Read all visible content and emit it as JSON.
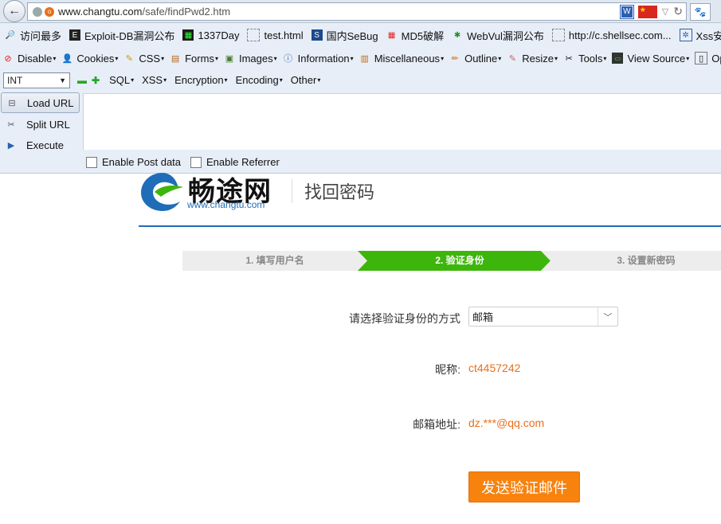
{
  "browser": {
    "url_host": "www.changtu.com",
    "url_path": "/safe/findPwd2.htm"
  },
  "bookmarks": [
    {
      "label": "访问最多",
      "icon": "magnifier-icon"
    },
    {
      "label": "Exploit-DB漏洞公布",
      "icon": "exploitdb-icon"
    },
    {
      "label": "1337Day",
      "icon": "1337day-icon"
    },
    {
      "label": "test.html",
      "icon": "blank-page-icon"
    },
    {
      "label": "国内SeBug",
      "icon": "sebug-icon"
    },
    {
      "label": "MD5破解",
      "icon": "grid-icon"
    },
    {
      "label": "WebVul漏洞公布",
      "icon": "bug-icon"
    },
    {
      "label": "http://c.shellsec.com...",
      "icon": "blank-page-icon"
    },
    {
      "label": "Xss安全测试",
      "icon": "xss-icon"
    }
  ],
  "webdev": [
    {
      "label": "Disable",
      "icon": "disable-icon"
    },
    {
      "label": "Cookies",
      "icon": "cookies-icon"
    },
    {
      "label": "CSS",
      "icon": "css-icon"
    },
    {
      "label": "Forms",
      "icon": "forms-icon"
    },
    {
      "label": "Images",
      "icon": "images-icon"
    },
    {
      "label": "Information",
      "icon": "info-icon"
    },
    {
      "label": "Miscellaneous",
      "icon": "misc-icon"
    },
    {
      "label": "Outline",
      "icon": "outline-icon"
    },
    {
      "label": "Resize",
      "icon": "resize-icon"
    },
    {
      "label": "Tools",
      "icon": "tools-icon"
    },
    {
      "label": "View Source",
      "icon": "view-source-icon"
    },
    {
      "label": "Op",
      "icon": "options-icon"
    }
  ],
  "hackbar": {
    "type_select": "INT",
    "menus": [
      "SQL",
      "XSS",
      "Encryption",
      "Encoding",
      "Other"
    ],
    "load_url": "Load URL",
    "split_url": "Split URL",
    "execute": "Execute",
    "enable_post": "Enable Post data",
    "enable_referrer": "Enable Referrer"
  },
  "page": {
    "brand": "畅途网",
    "brand_url": "www.changtu.com",
    "title": "找回密码",
    "steps": [
      "1. 填写用户名",
      "2. 验证身份",
      "3. 设置新密码"
    ],
    "active_step": 2,
    "verify_method_label": "请选择验证身份的方式",
    "verify_method_value": "邮箱",
    "nickname_label": "昵称:",
    "nickname_value": "ct4457242",
    "email_label": "邮箱地址:",
    "email_value": "dz.***@qq.com",
    "send_button": "发送验证邮件"
  },
  "colors": {
    "accent_green": "#3db60b",
    "accent_orange": "#f8820e",
    "brand_blue": "#1f6db8"
  }
}
